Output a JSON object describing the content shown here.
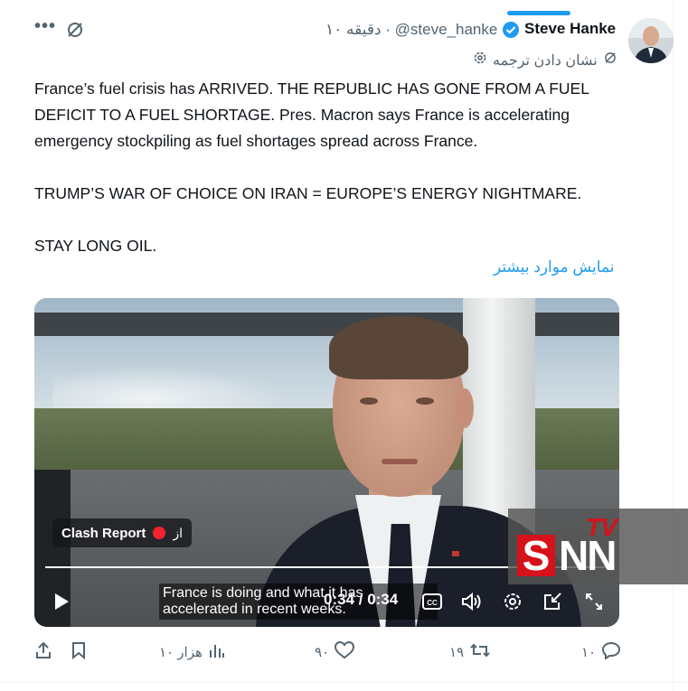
{
  "header": {
    "more_label": "•••",
    "author_name": "Steve Hanke",
    "handle": "@steve_hanke",
    "time_ago": "۱۰ دقیقه",
    "translate_label": "نشان دادن ترجمه"
  },
  "post": {
    "paragraphs": [
      "France’s fuel crisis has ARRIVED.  THE REPUBLIC HAS GONE FROM A FUEL DEFICIT TO A FUEL SHORTAGE. Pres. Macron says France is accelerating emergency stockpiling as fuel shortages spread across France.",
      "TRUMP’S WAR OF CHOICE ON IRAN = EUROPE’S ENERGY NIGHTMARE.",
      "STAY LONG OIL."
    ],
    "show_more": "نمایش موارد بیشتر"
  },
  "video": {
    "source_name": "Clash Report",
    "source_prefix": "از",
    "subtitle": "France is doing and what it has accelerated in recent weeks.",
    "time": "0:34 / 0:34",
    "progress": 1.0,
    "controls": [
      "play-icon",
      "cc-icon",
      "volume-icon",
      "settings-icon",
      "pip-icon",
      "fullscreen-icon"
    ]
  },
  "watermark": {
    "tv": "TV",
    "s": "S",
    "nn": "NN"
  },
  "actions": {
    "replies": "۱۰",
    "reposts": "۱۹",
    "likes": "۹۰",
    "views": "۱۰ هزار"
  },
  "colors": {
    "accent": "#1d9bf0",
    "text": "#0f1419",
    "muted": "#536471",
    "watermark_red": "#d5121a"
  }
}
